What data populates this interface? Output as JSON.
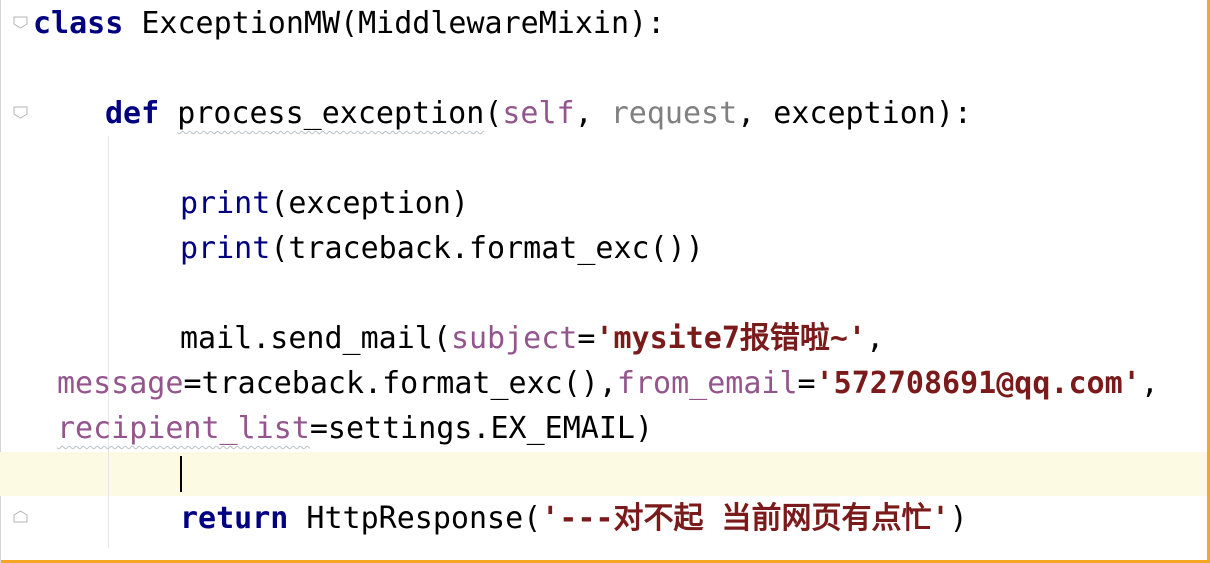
{
  "colors": {
    "keyword": "#000080",
    "param": "#94558d",
    "unused": "#808080",
    "string": "#7b1a1a",
    "current_line_bg": "#fdfae4",
    "frame_border": "#f5a623"
  },
  "editor": {
    "line1": {
      "kw": "class",
      "rest": " ExceptionMW(MiddlewareMixin):"
    },
    "line2": {
      "kw": "def",
      "sp": " ",
      "name": "process_exception",
      "open": "(",
      "self": "self",
      "c1": ", ",
      "request": "request",
      "c2": ", ",
      "exception": "exception",
      "close": "):"
    },
    "line3": {
      "fn": "print",
      "rest": "(exception)"
    },
    "line4": {
      "fn": "print",
      "rest": "(traceback.format_exc())"
    },
    "line5": {
      "pre": "mail.send_mail(",
      "param": "subject",
      "eq": "=",
      "str": "'mysite7报错啦~'",
      "end": ","
    },
    "line6": {
      "param": "message",
      "mid": "=traceback.format_exc(),",
      "param2": "from_email",
      "eq": "=",
      "str": "'572708691@qq.com'",
      "end": ","
    },
    "line7": {
      "param": "recipient_list",
      "rest": "=settings.EX_EMAIL)"
    },
    "line8": {
      "kw": "return",
      "mid": " HttpResponse(",
      "str": "'---对不起 当前网页有点忙'",
      "end": ")"
    }
  }
}
